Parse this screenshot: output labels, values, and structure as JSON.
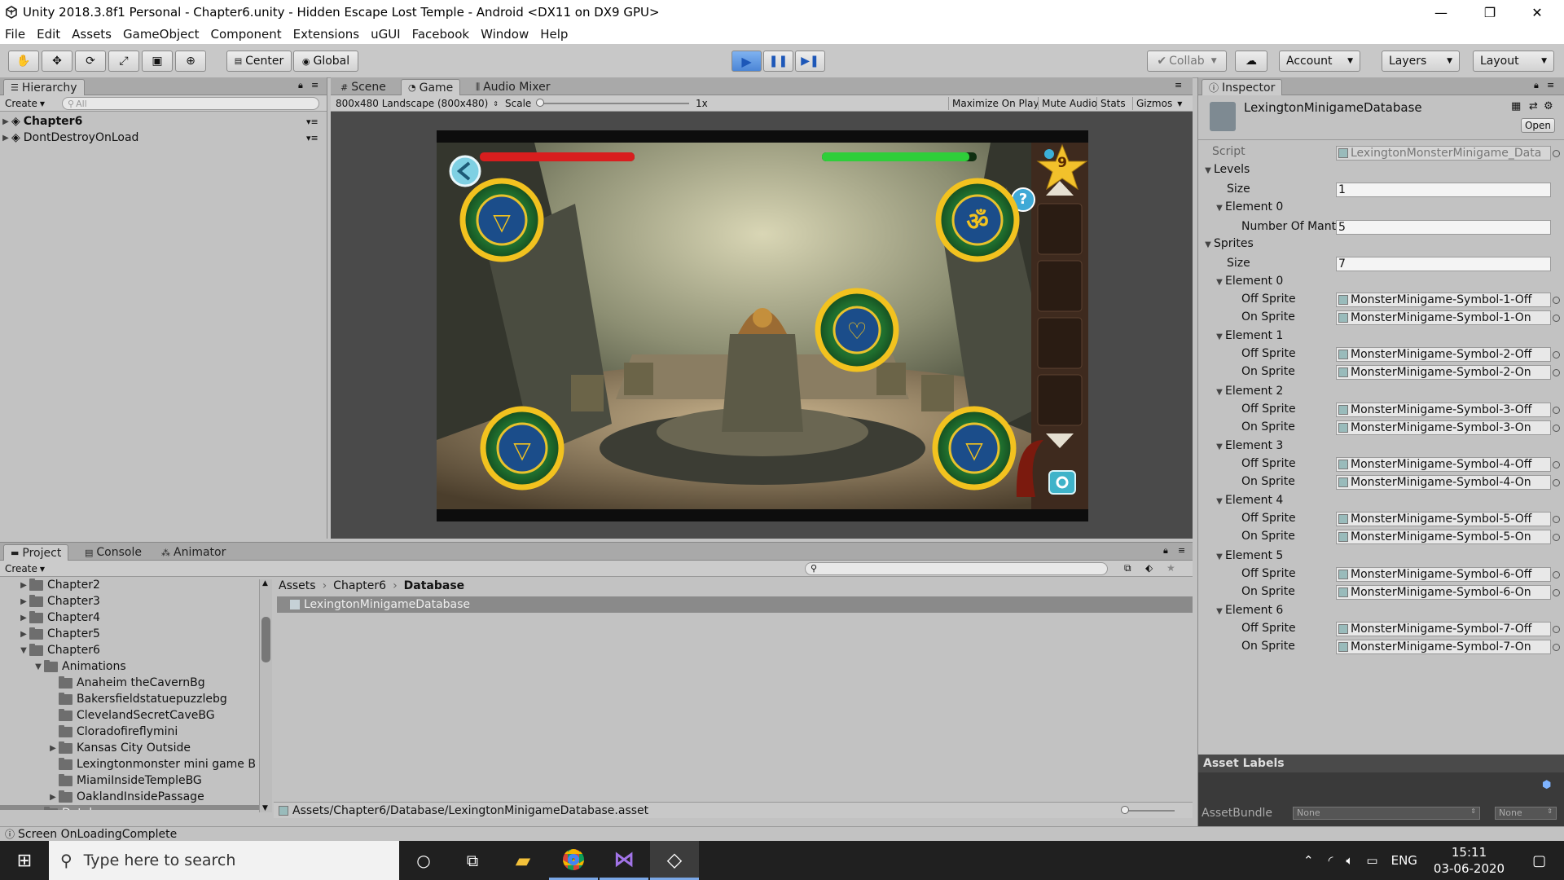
{
  "window": {
    "title": "Unity 2018.3.8f1 Personal - Chapter6.unity - Hidden Escape Lost Temple - Android <DX11 on DX9 GPU>",
    "controls": [
      "—",
      "❐",
      "✕"
    ]
  },
  "menu": [
    "File",
    "Edit",
    "Assets",
    "GameObject",
    "Component",
    "Extensions",
    "uGUI",
    "Facebook",
    "Window",
    "Help"
  ],
  "toolbar": {
    "pivot": "Center",
    "space": "Global",
    "collab": "Collab",
    "account": "Account",
    "layers": "Layers",
    "layout": "Layout"
  },
  "hierarchy": {
    "tab": "Hierarchy",
    "create": "Create",
    "search_placeholder": "All",
    "items": [
      "Chapter6",
      "DontDestroyOnLoad"
    ]
  },
  "scene_tabs": {
    "scene": "Scene",
    "game": "Game",
    "audio_mixer": "Audio Mixer"
  },
  "game_bar": {
    "resolution": "800x480 Landscape (800x480)",
    "scale_label": "Scale",
    "scale_value": "1x",
    "maximize": "Maximize On Play",
    "mute": "Mute Audio",
    "stats": "Stats",
    "gizmos": "Gizmos"
  },
  "game": {
    "star_count": "9",
    "enemy_health": 1.0,
    "player_health": 0.95
  },
  "inspector": {
    "tab": "Inspector",
    "asset_name": "LexingtonMinigameDatabase",
    "open": "Open",
    "script_label": "Script",
    "script_value": "LexingtonMonsterMinigame_Data",
    "levels_label": "Levels",
    "size_label": "Size",
    "levels_size": "1",
    "element0_label": "Element 0",
    "number_label": "Number Of Mant",
    "number_value": "5",
    "sprites_label": "Sprites",
    "sprites_size": "7",
    "off_label": "Off Sprite",
    "on_label": "On Sprite",
    "elements": [
      {
        "label": "Element 0",
        "off": "MonsterMinigame-Symbol-1-Off",
        "on": "MonsterMinigame-Symbol-1-On"
      },
      {
        "label": "Element 1",
        "off": "MonsterMinigame-Symbol-2-Off",
        "on": "MonsterMinigame-Symbol-2-On"
      },
      {
        "label": "Element 2",
        "off": "MonsterMinigame-Symbol-3-Off",
        "on": "MonsterMinigame-Symbol-3-On"
      },
      {
        "label": "Element 3",
        "off": "MonsterMinigame-Symbol-4-Off",
        "on": "MonsterMinigame-Symbol-4-On"
      },
      {
        "label": "Element 4",
        "off": "MonsterMinigame-Symbol-5-Off",
        "on": "MonsterMinigame-Symbol-5-On"
      },
      {
        "label": "Element 5",
        "off": "MonsterMinigame-Symbol-6-Off",
        "on": "MonsterMinigame-Symbol-6-On"
      },
      {
        "label": "Element 6",
        "off": "MonsterMinigame-Symbol-7-Off",
        "on": "MonsterMinigame-Symbol-7-On"
      }
    ],
    "asset_labels": "Asset Labels",
    "asset_bundle": "AssetBundle",
    "bundle_none": "None",
    "variant_none": "None"
  },
  "project": {
    "tabs": [
      "Project",
      "Console",
      "Animator"
    ],
    "create": "Create",
    "folders": [
      {
        "name": "Chapter2",
        "depth": 1,
        "arrow": "▶"
      },
      {
        "name": "Chapter3",
        "depth": 1,
        "arrow": "▶"
      },
      {
        "name": "Chapter4",
        "depth": 1,
        "arrow": "▶"
      },
      {
        "name": "Chapter5",
        "depth": 1,
        "arrow": "▶"
      },
      {
        "name": "Chapter6",
        "depth": 1,
        "arrow": "▼"
      },
      {
        "name": "Animations",
        "depth": 2,
        "arrow": "▼"
      },
      {
        "name": "Anaheim theCavernBg",
        "depth": 3,
        "arrow": ""
      },
      {
        "name": "Bakersfieldstatuepuzzlebg",
        "depth": 3,
        "arrow": ""
      },
      {
        "name": "ClevelandSecretCaveBG",
        "depth": 3,
        "arrow": ""
      },
      {
        "name": "Cloradofireflymini",
        "depth": 3,
        "arrow": ""
      },
      {
        "name": "Kansas City Outside",
        "depth": 3,
        "arrow": "▶"
      },
      {
        "name": "Lexingtonmonster mini game B",
        "depth": 3,
        "arrow": ""
      },
      {
        "name": "MiamiInsideTempleBG",
        "depth": 3,
        "arrow": ""
      },
      {
        "name": "OaklandInsidePassage",
        "depth": 3,
        "arrow": "▶"
      },
      {
        "name": "Database",
        "depth": 2,
        "arrow": ""
      }
    ],
    "breadcrumb": [
      "Assets",
      "Chapter6",
      "Database"
    ],
    "selected_asset": "LexingtonMinigameDatabase",
    "path": "Assets/Chapter6/Database/LexingtonMinigameDatabase.asset"
  },
  "status": "Screen OnLoadingComplete",
  "taskbar": {
    "search_placeholder": "Type here to search",
    "lang": "ENG",
    "time": "15:11",
    "date": "03-06-2020"
  },
  "colors": {
    "play_blue": "#3a7fd9",
    "health_red": "#d81e1e",
    "health_green": "#2fce3a"
  }
}
